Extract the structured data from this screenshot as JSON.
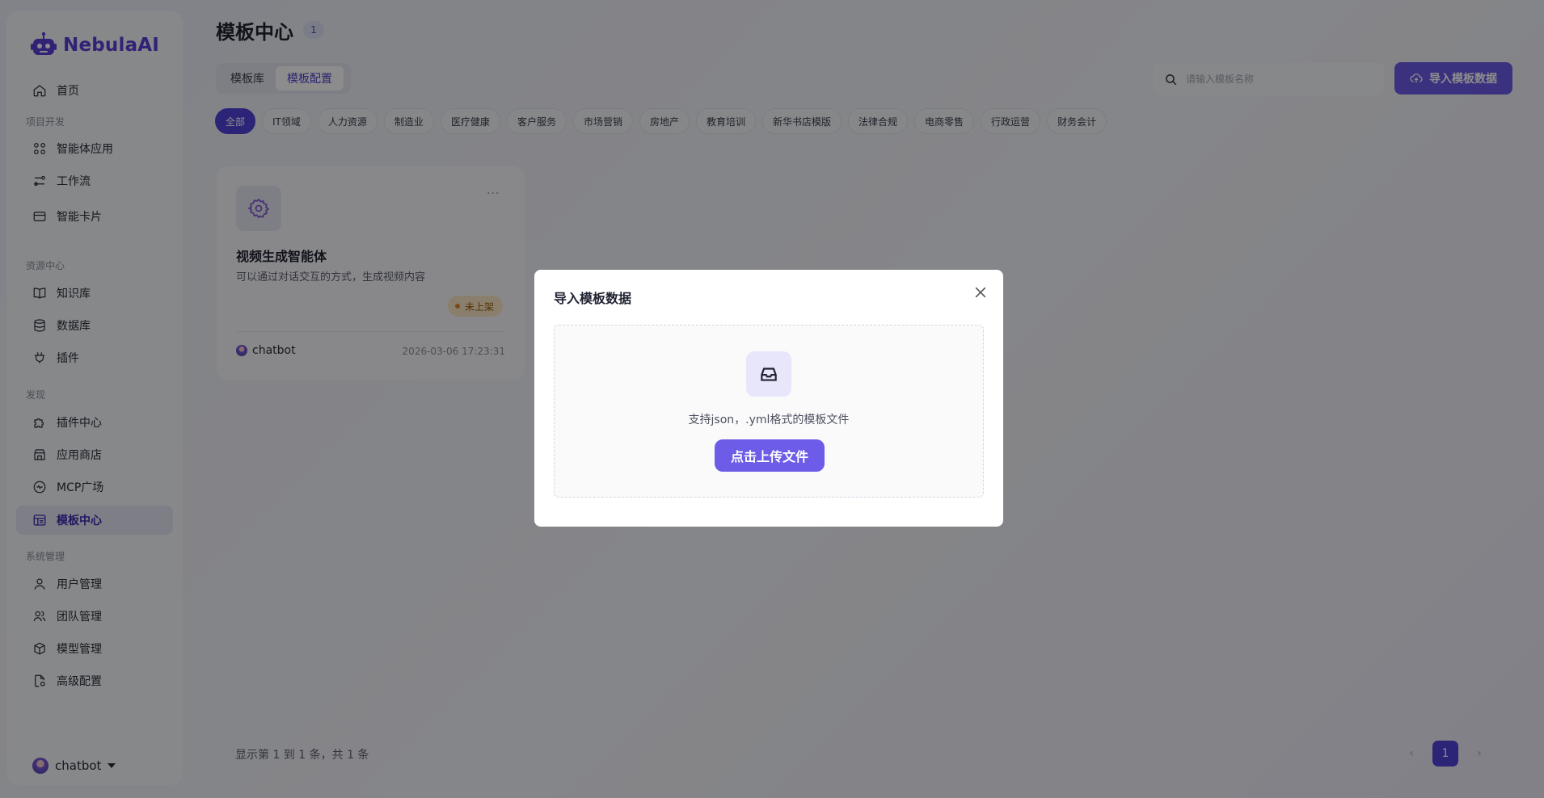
{
  "app": {
    "logo_text": "NebulaAI"
  },
  "sidebar": {
    "items": [
      {
        "label": "首页",
        "icon": "home-icon"
      },
      {
        "group": "项目开发"
      },
      {
        "label": "智能体应用",
        "icon": "apps-grid-icon"
      },
      {
        "label": "工作流",
        "icon": "workflow-icon"
      },
      {
        "label": "智能卡片",
        "icon": "card-icon"
      },
      {
        "group": "资源中心"
      },
      {
        "label": "知识库",
        "icon": "book-icon"
      },
      {
        "label": "数据库",
        "icon": "database-icon"
      },
      {
        "label": "插件",
        "icon": "plug-icon"
      },
      {
        "group": "发现"
      },
      {
        "label": "插件中心",
        "icon": "puzzle-icon"
      },
      {
        "label": "应用商店",
        "icon": "store-icon"
      },
      {
        "label": "MCP广场",
        "icon": "mcp-icon"
      },
      {
        "label": "模板中心",
        "icon": "template-icon",
        "active": true
      },
      {
        "group": "系统管理"
      },
      {
        "label": "用户管理",
        "icon": "user-icon"
      },
      {
        "label": "团队管理",
        "icon": "team-icon"
      },
      {
        "label": "模型管理",
        "icon": "model-cube-icon"
      },
      {
        "label": "高级配置",
        "icon": "file-settings-icon"
      }
    ],
    "user": {
      "name": "chatbot"
    }
  },
  "main": {
    "title": "模板中心",
    "count": "1",
    "tabs": [
      {
        "label": "模板库"
      },
      {
        "label": "模板配置",
        "active": true
      }
    ],
    "search": {
      "placeholder": "请输入模板名称"
    },
    "import_button": "导入模板数据",
    "categories": [
      "全部",
      "IT领域",
      "人力资源",
      "制造业",
      "医疗健康",
      "客户服务",
      "市场营销",
      "房地产",
      "教育培训",
      "新华书店模版",
      "法律合规",
      "电商零售",
      "行政运营",
      "财务会计"
    ],
    "active_category": "全部",
    "cards": [
      {
        "title": "视频生成智能体",
        "description": "可以通过对话交互的方式，生成视频内容",
        "status": "未上架",
        "owner": "chatbot",
        "time": "2026-03-06 17:23:31",
        "icon": "gear-icon",
        "more": "···"
      }
    ],
    "pagination": {
      "summary": "显示第 1 到 1 条，共 1 条",
      "current_page": "1",
      "prev": "‹",
      "next": "›"
    }
  },
  "modal": {
    "title": "导入模板数据",
    "hint": "支持json，.yml格式的模板文件",
    "upload_button": "点击上传文件"
  },
  "colors": {
    "accent": "#6c5ce7",
    "active_chip": "#4f43d9",
    "status_bg": "#fbe8c6",
    "overlay": "rgba(0,0,0,0.45)"
  }
}
